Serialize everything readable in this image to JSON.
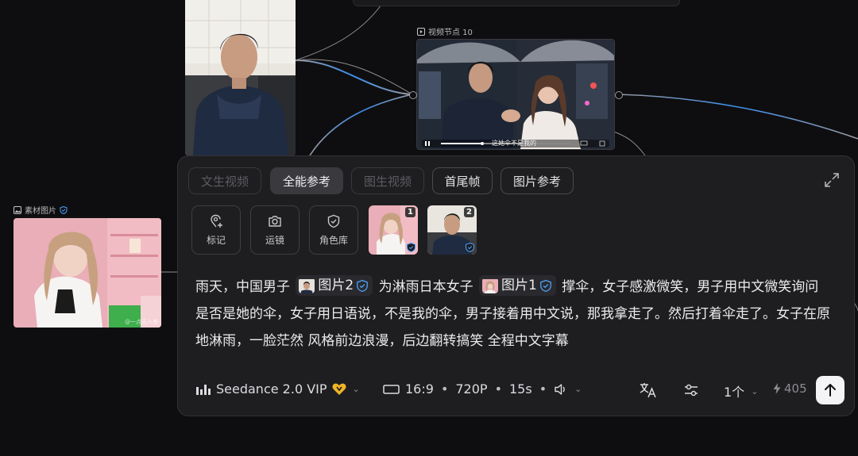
{
  "nodes": {
    "video": {
      "title": "视频节点 10",
      "subtitle": "这她伞不是我的"
    },
    "material": {
      "title": "素材图片",
      "watermark": "@一点无人有"
    }
  },
  "panel": {
    "tabs": [
      {
        "label": "文生视频",
        "state": "disabled"
      },
      {
        "label": "全能参考",
        "state": "active"
      },
      {
        "label": "图生视频",
        "state": "disabled"
      },
      {
        "label": "首尾帧",
        "state": "normal"
      },
      {
        "label": "图片参考",
        "state": "normal"
      }
    ],
    "tools": [
      {
        "label": "标记",
        "icon": "map-pin-add-icon"
      },
      {
        "label": "运镜",
        "icon": "camera-icon"
      },
      {
        "label": "角色库",
        "icon": "shield-check-icon"
      }
    ],
    "refs": [
      {
        "num": "1",
        "icon": "verified-badge-icon"
      },
      {
        "num": "2",
        "icon": "verified-badge-icon"
      }
    ],
    "prompt": {
      "seg1": "雨天，中国男子",
      "mention1": "图片2",
      "seg2": "为淋雨日本女子",
      "mention2": "图片1",
      "seg3": "撑伞，女子感激微笑，男子用中文微笑询问是否是她的伞，女子用日语说，不是我的伞，男子接着用中文说，那我拿走了。然后打着伞走了。女子在原地淋雨，一脸茫然 风格前边浪漫，后边翻转搞笑 全程中文字幕"
    },
    "model": {
      "name": "Seedance 2.0 VIP",
      "icon": "signal-bars-icon",
      "badge": "vip-heart-icon"
    },
    "settings": {
      "ratio": "16:9",
      "resolution": "720P",
      "duration": "15s",
      "audio_icon": "speaker-icon"
    },
    "count": "1个",
    "credits": "405",
    "colors": {
      "panel_bg": "#1e1e21",
      "vip_gold": "#f0b429",
      "verified_blue": "#4da3ff",
      "wire_blue": "#3b8be8"
    }
  }
}
